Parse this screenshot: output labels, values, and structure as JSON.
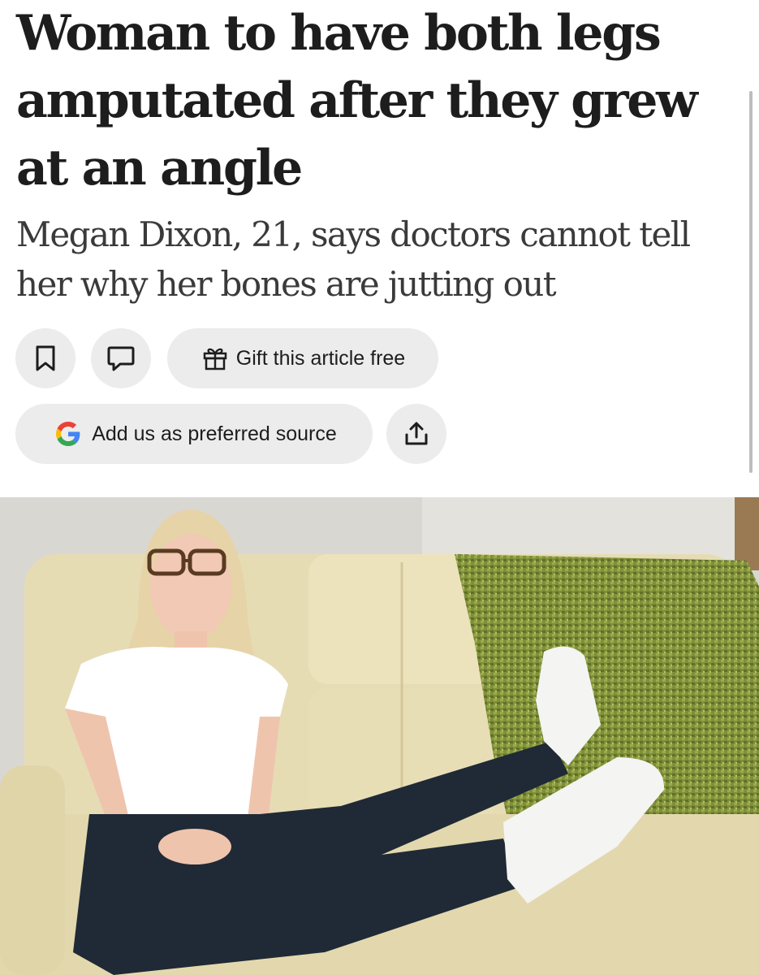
{
  "article": {
    "headline": "Woman to have both legs amputated after they grew at an angle",
    "standfirst": "Megan Dixon, 21, says doctors cannot tell her why her bones are jutting out"
  },
  "actions": {
    "bookmark_icon": "bookmark-icon",
    "comment_icon": "comment-icon",
    "gift_icon": "gift-icon",
    "gift_label": "Gift this article free",
    "google_icon": "google-g-icon",
    "preferred_source_label": "Add us as preferred source",
    "share_icon": "share-icon"
  },
  "colors": {
    "text": "#1d1d1d",
    "standfirst": "#3a3a3a",
    "pill_background": "#ececec",
    "google_blue": "#4285F4",
    "google_red": "#EA4335",
    "google_yellow": "#FBBC05",
    "google_green": "#34A853"
  }
}
